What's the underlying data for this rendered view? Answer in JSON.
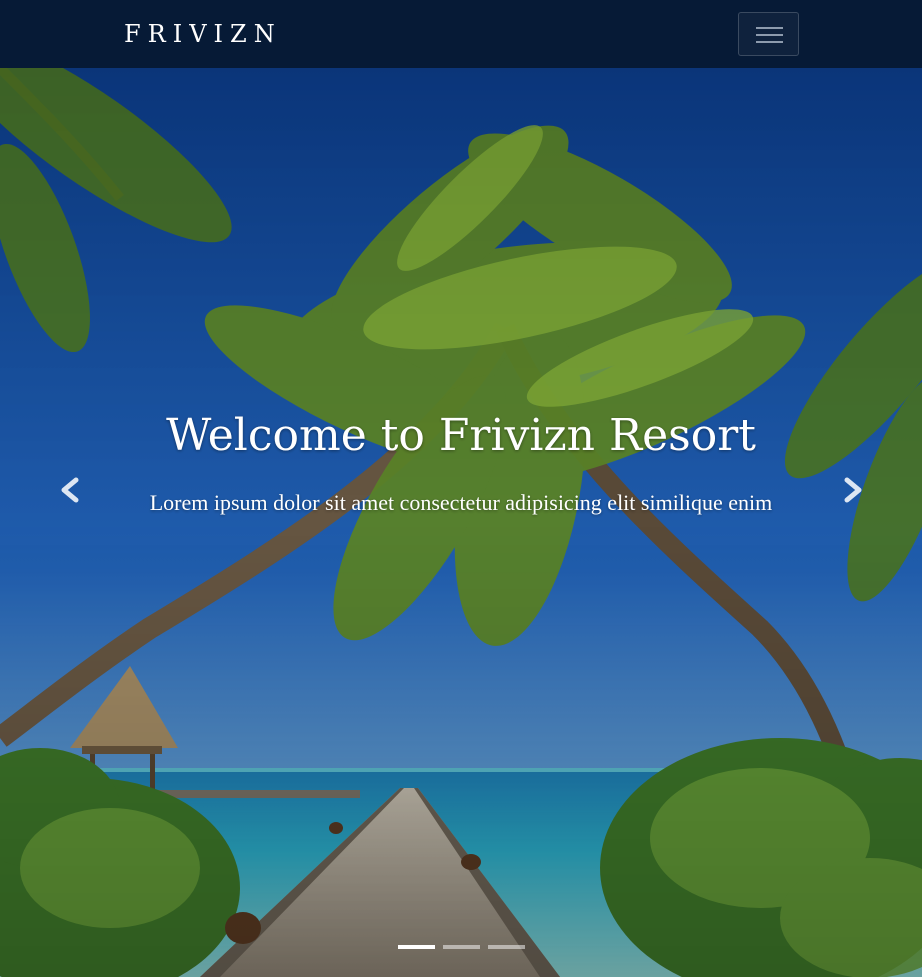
{
  "navbar": {
    "brand": "FRIVIZN",
    "toggle_icon": "hamburger-menu-icon"
  },
  "hero": {
    "title": "Welcome to Frivizn Resort",
    "subtitle": "Lorem ipsum dolor sit amet consectetur adipisicing elit similique enim",
    "prev_icon": "chevron-left-icon",
    "next_icon": "chevron-right-icon",
    "slides": 3,
    "active_slide": 1
  },
  "colors": {
    "navbar_bg": "#061a36",
    "text": "#ffffff",
    "sky": "#1f5fb0",
    "sea": "#2aa6c8"
  }
}
